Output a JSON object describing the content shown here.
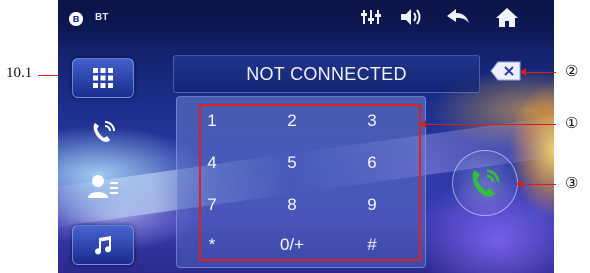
{
  "annotations": {
    "left_label": "10.1",
    "callouts": [
      "②",
      "①",
      "③"
    ]
  },
  "status_bar": {
    "bt_label": "BT",
    "icons": [
      "bluetooth-icon",
      "equalizer-icon",
      "volume-icon",
      "back-icon",
      "home-icon"
    ]
  },
  "side_menu": {
    "items": [
      "dial-pad",
      "call-log",
      "contacts",
      "bt-music"
    ],
    "icons": [
      "grid-icon",
      "phone-log-icon",
      "contacts-icon",
      "music-note-icon"
    ]
  },
  "display": {
    "text": "NOT CONNECTED"
  },
  "keypad": {
    "keys": [
      "1",
      "2",
      "3",
      "4",
      "5",
      "6",
      "7",
      "8",
      "9",
      "*",
      "0/+",
      "#"
    ]
  },
  "colors": {
    "highlight": "#e0201c",
    "call_green": "#2fbf3a",
    "backspace_red": "#d2201c"
  }
}
